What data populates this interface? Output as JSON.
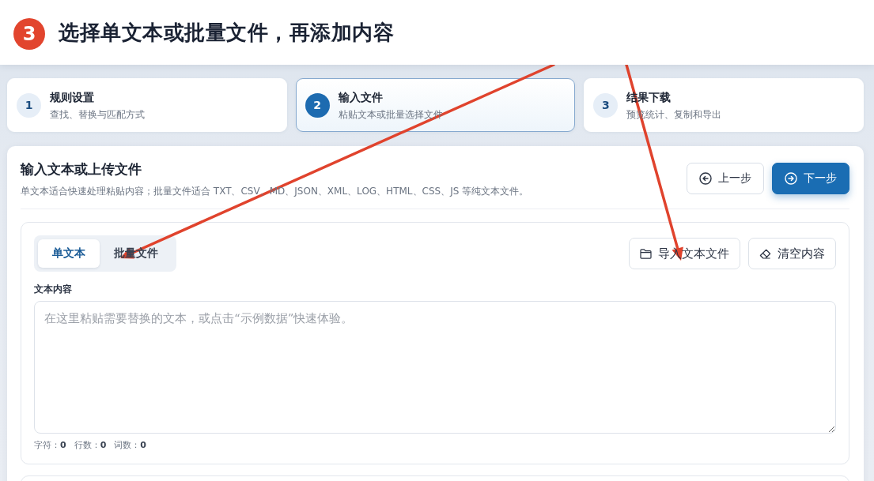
{
  "tutorial_banner": {
    "step_number": "3",
    "title": "选择单文本或批量文件，再添加内容"
  },
  "steps": [
    {
      "number": "1",
      "title": "规则设置",
      "subtitle": "查找、替换与匹配方式",
      "selected": false
    },
    {
      "number": "2",
      "title": "输入文件",
      "subtitle": "粘贴文本或批量选择文件",
      "selected": true
    },
    {
      "number": "3",
      "title": "结果下载",
      "subtitle": "预览统计、复制和导出",
      "selected": false
    }
  ],
  "panel": {
    "title": "输入文本或上传文件",
    "description": "单文本适合快速处理粘贴内容；批量文件适合 TXT、CSV、MD、JSON、XML、LOG、HTML、CSS、JS 等纯文本文件。",
    "buttons": [
      {
        "label": "上一步",
        "kind": "secondary"
      },
      {
        "label": "下一步",
        "kind": "primary"
      }
    ]
  },
  "input_card": {
    "mode_tabs": [
      {
        "label": "单文本",
        "selected": true
      },
      {
        "label": "批量文件",
        "selected": false
      }
    ],
    "actions": [
      {
        "label": "导入文本文件"
      },
      {
        "label": "清空内容"
      }
    ],
    "field_label": "文本内容",
    "text_field": {
      "placeholder": "在这里粘贴需要替换的文本，或点击“示例数据”快速体验。"
    },
    "stats": [
      {
        "label": "字符：",
        "value": "0"
      },
      {
        "label": "行数：",
        "value": "0"
      },
      {
        "label": "词数：",
        "value": "0"
      }
    ]
  }
}
